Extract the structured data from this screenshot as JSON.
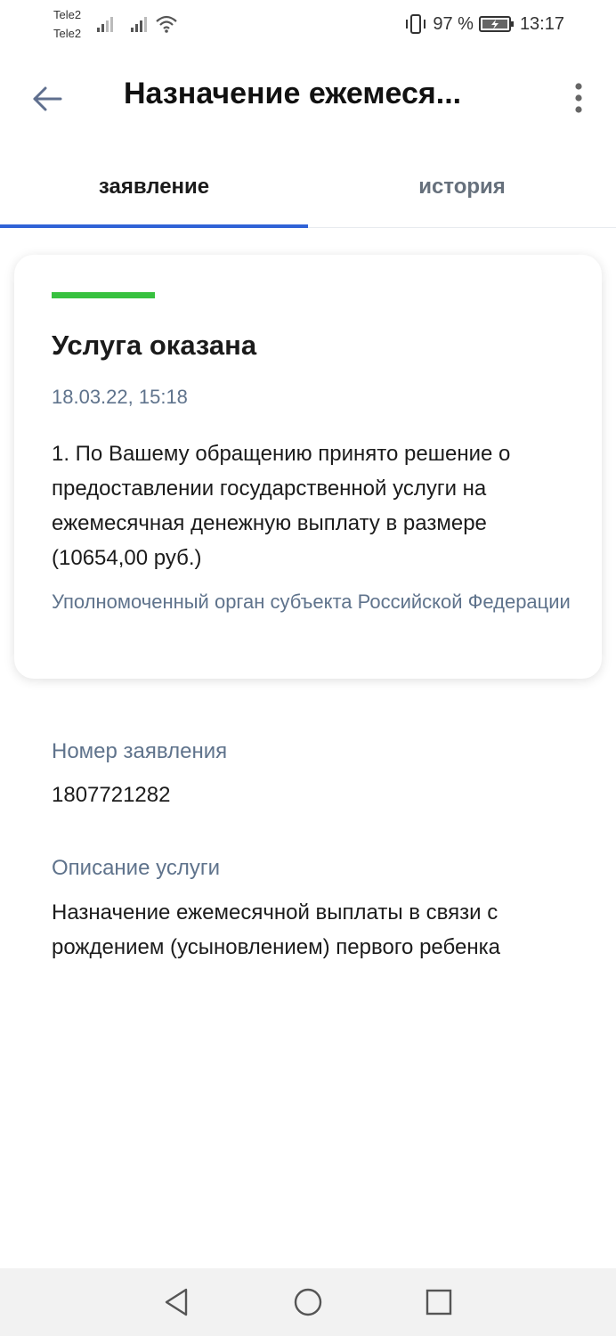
{
  "status_bar": {
    "carrier_1": "Tele2",
    "carrier_2": "Tele2",
    "battery": "97 %",
    "time": "13:17"
  },
  "app_bar": {
    "title": "Назначение ежемеся...",
    "back_icon": "arrow-left-icon",
    "menu_icon": "more-vertical-icon"
  },
  "tabs": [
    {
      "label": "заявление",
      "active": true
    },
    {
      "label": "история",
      "active": false
    }
  ],
  "status_card": {
    "status": "Услуга оказана",
    "status_color": "#37c13f",
    "date": "18.03.22, 15:18",
    "message": "1. По Вашему обращению принято решение о предоставлении государственной услуги на ежемесячная денежную выплату в размере (10654,00 руб.)",
    "organization": "Уполномоченный орган субъекта Российской Федерации"
  },
  "details": {
    "number_label": "Номер заявления",
    "number_value": "1807721282",
    "description_label": "Описание услуги",
    "description_value": "Назначение ежемесячной выплаты в связи с рождением (усыновлением) первого ребенка"
  },
  "colors": {
    "accent": "#2f62d6",
    "muted_text": "#5f738c"
  }
}
